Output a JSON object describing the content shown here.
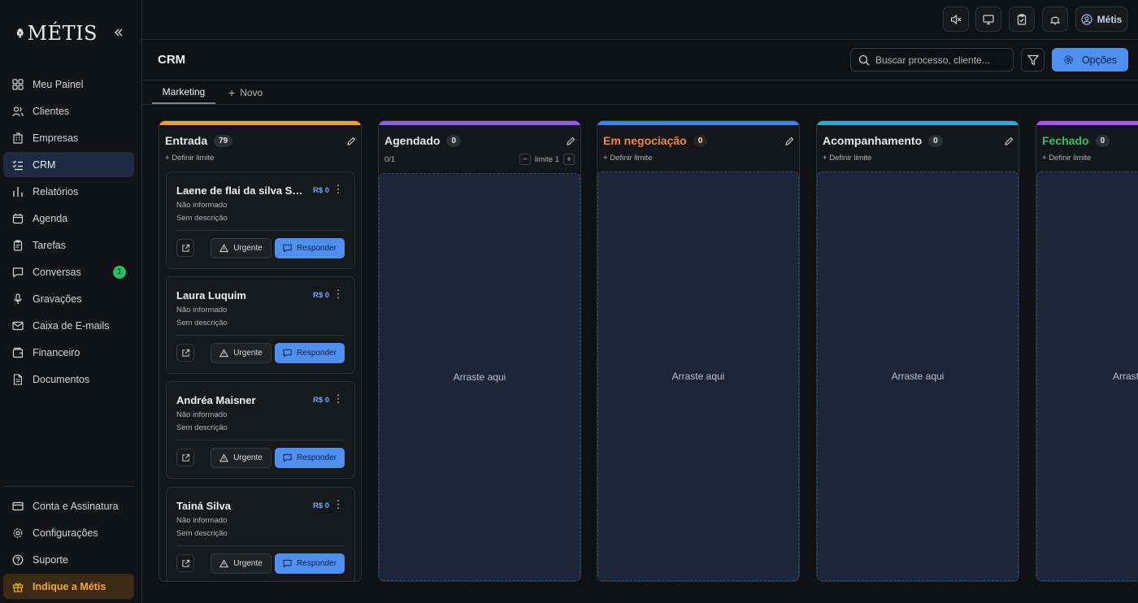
{
  "brand": {
    "name": "MÉTIS"
  },
  "sidebar": {
    "items": [
      {
        "label": "Meu Painel",
        "icon": "dashboard-icon"
      },
      {
        "label": "Clientes",
        "icon": "users-icon"
      },
      {
        "label": "Empresas",
        "icon": "building-icon"
      },
      {
        "label": "CRM",
        "icon": "list-check-icon",
        "active": true
      },
      {
        "label": "Relatórios",
        "icon": "bar-chart-icon"
      },
      {
        "label": "Agenda",
        "icon": "calendar-icon"
      },
      {
        "label": "Tarefas",
        "icon": "clipboard-icon"
      },
      {
        "label": "Conversas",
        "icon": "chat-icon",
        "badge": "1"
      },
      {
        "label": "Gravações",
        "icon": "microphone-icon"
      },
      {
        "label": "Caixa de E-mails",
        "icon": "mail-icon"
      },
      {
        "label": "Financeiro",
        "icon": "wallet-icon"
      },
      {
        "label": "Documentos",
        "icon": "document-icon"
      }
    ],
    "bottom": [
      {
        "label": "Conta e Assinatura",
        "icon": "credit-card-icon"
      },
      {
        "label": "Configurações",
        "icon": "gear-icon"
      },
      {
        "label": "Suporte",
        "icon": "help-icon"
      },
      {
        "label": "Indique a Métis",
        "icon": "gift-icon"
      }
    ]
  },
  "topbar": {
    "user": "Métis"
  },
  "header": {
    "title": "CRM",
    "search_placeholder": "Buscar processo, cliente...",
    "options_label": "Opções"
  },
  "tabs": {
    "active": "Marketing",
    "new": "Novo"
  },
  "columns": [
    {
      "title": "Entrada",
      "count": "79",
      "color": "#f2a11f",
      "limit_label": "Definir limite"
    },
    {
      "title": "Agendado",
      "count": "0",
      "color": "#8b5cf6",
      "fraction": "0/1",
      "limit_text": "limite 1",
      "dropzone": "Arraste aqui"
    },
    {
      "title": "Em negociação",
      "count": "0",
      "color": "#3b82f6",
      "title_color": "#f0873a",
      "limit_label": "Definir limite",
      "dropzone": "Arraste aqui"
    },
    {
      "title": "Acompanhamento",
      "count": "0",
      "color": "#14b8d4",
      "limit_label": "Definir limite",
      "dropzone": "Arraste aqui"
    },
    {
      "title": "Fechado",
      "count": "0",
      "color": "#a855f7",
      "title_color": "#2fc26a",
      "limit_label": "Definir limite",
      "dropzone": "Arraste"
    }
  ],
  "cards": [
    {
      "name": "Laene de flai da silva Sobrinho",
      "value": "R$ 0",
      "line1": "Não informado",
      "line2": "Sem descrição",
      "urgent": "Urgente",
      "reply": "Responder"
    },
    {
      "name": "Laura Luquim",
      "value": "R$ 0",
      "line1": "Não informado",
      "line2": "Sem descrição",
      "urgent": "Urgente",
      "reply": "Responder"
    },
    {
      "name": "Andréa Maisner",
      "value": "R$ 0",
      "line1": "Não informado",
      "line2": "Sem descrição",
      "urgent": "Urgente",
      "reply": "Responder"
    },
    {
      "name": "Tainá Silva",
      "value": "R$ 0",
      "line1": "Não informado",
      "line2": "Sem descrição",
      "urgent": "Urgente",
      "reply": "Responder"
    }
  ]
}
